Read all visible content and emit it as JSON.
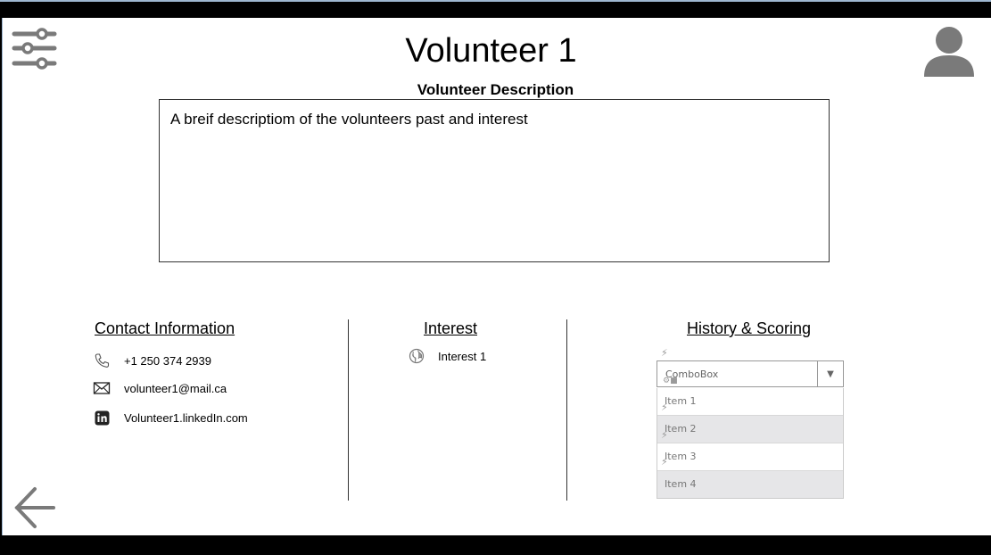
{
  "header": {
    "title": "Volunteer 1"
  },
  "description": {
    "heading": "Volunteer Description",
    "text": "A breif descriptiom of the volunteers past and interest"
  },
  "contact": {
    "heading": "Contact Information",
    "phone": "+1 250 374 2939",
    "email": "volunteer1@mail.ca",
    "linkedin": "Volunteer1.linkedIn.com"
  },
  "interest": {
    "heading": "Interest",
    "items": [
      "Interest 1"
    ]
  },
  "history": {
    "heading": "History & Scoring",
    "combo": {
      "value": "ComboBox",
      "options": [
        "Item 1",
        "Item 2",
        "Item 3",
        "Item 4"
      ]
    }
  },
  "icons": {
    "filter": "sliders-icon",
    "user": "user-avatar-icon",
    "back": "back-arrow-icon",
    "phone": "phone-icon",
    "email": "envelope-icon",
    "linkedin": "linkedin-icon",
    "globe": "globe-icon"
  },
  "colors": {
    "icon_gray": "#7a7a7a",
    "frame_border": "#9db6cf"
  }
}
